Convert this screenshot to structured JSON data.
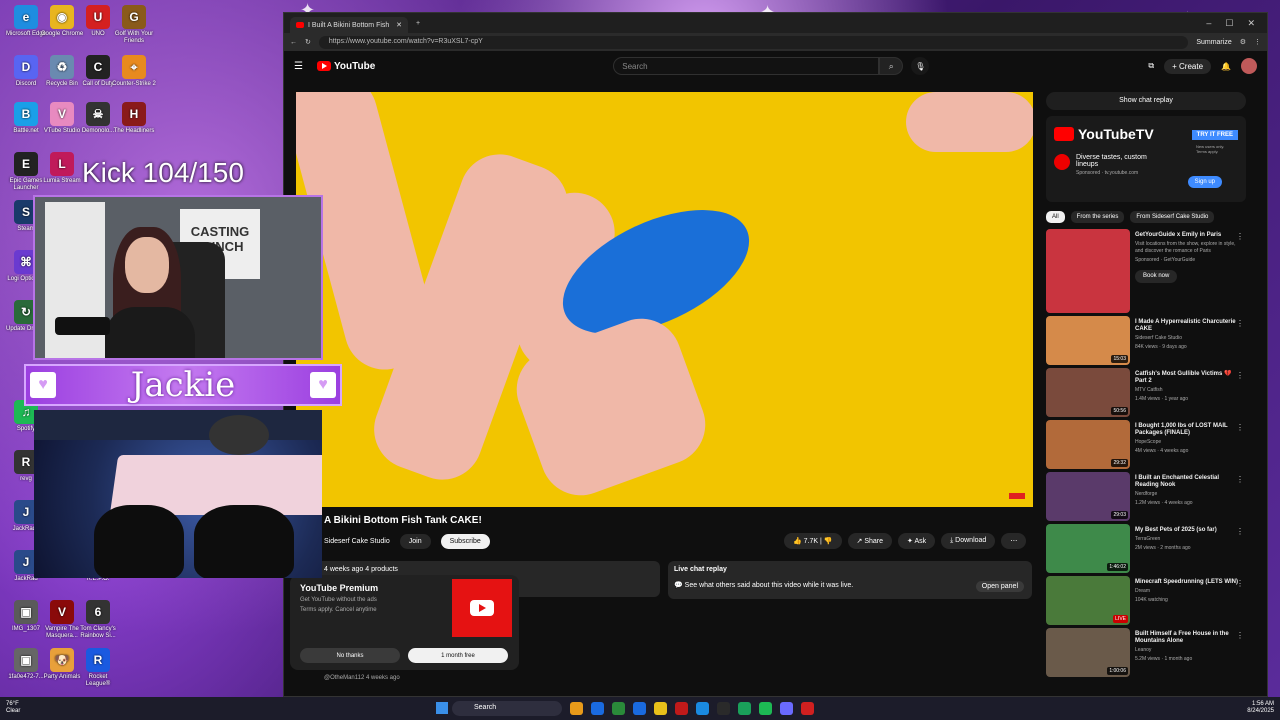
{
  "browser": {
    "tab_title": "I Built A Bikini Bottom Fish",
    "url": "https://www.youtube.com/watch?v=R3uXSL7-cpY",
    "summarize_label": "Summarize"
  },
  "youtube": {
    "logo_text": "YouTube",
    "search_placeholder": "Search",
    "create_label": "Create",
    "video": {
      "title": "A Bikini Bottom Fish Tank CAKE!",
      "channel": "Sideserf Cake Studio",
      "join_label": "Join",
      "subscribe_label": "Subscribe",
      "likes": "7.7K",
      "share_label": "Share",
      "ask_label": "Ask",
      "download_label": "Download",
      "meta": "4 weeks ago  4 products"
    },
    "live_chat": {
      "title": "Live chat replay",
      "text": "See what others said about this video while it was live.",
      "open_label": "Open panel"
    },
    "premium": {
      "title": "YouTube Premium",
      "subtitle": "Get YouTube without the ads",
      "terms": "Terms apply. Cancel anytime",
      "no_label": "No thanks",
      "yes_label": "1 month free"
    },
    "comment_user": "@OtheMan112  4 weeks ago",
    "sidebar": {
      "show_chat_label": "Show chat replay",
      "ad": {
        "brand": "YouTubeTV",
        "try_label": "TRY IT FREE",
        "try_sub": "New users only. Terms apply.",
        "headline": "Diverse tastes, custom lineups",
        "sponsored": "Sponsored · tv.youtube.com",
        "signup_label": "Sign up"
      },
      "chips": [
        "All",
        "From the series",
        "From Sideserf Cake Studio"
      ],
      "recs": [
        {
          "title": "GetYourGuide x Emily in Paris",
          "channel": "Visit locations from the show, explore in style, and discover the romance of Paris",
          "meta": "Sponsored · GetYourGuide",
          "duration": "",
          "book": "Book now",
          "thumb_color": "#c9343f"
        },
        {
          "title": "I Made A Hyperrealistic Charcuterie CAKE",
          "channel": "Sideserf Cake Studio",
          "meta": "84K views · 9 days ago",
          "duration": "15:03",
          "thumb_color": "#d58a4a"
        },
        {
          "title": "Catfish's Most Gullible Victims 💔 Part 2",
          "channel": "MTV Catfish",
          "meta": "1.4M views · 1 year ago",
          "duration": "50:56",
          "thumb_color": "#7a4a3c"
        },
        {
          "title": "I Bought 1,000 lbs of LOST MAIL Packages (FINALE)",
          "channel": "HopeScope",
          "meta": "4M views · 4 weeks ago",
          "duration": "29:32",
          "thumb_color": "#b26a3a"
        },
        {
          "title": "I Built an Enchanted Celestial Reading Nook",
          "channel": "Nerdforge",
          "meta": "1.2M views · 4 weeks ago",
          "duration": "29:03",
          "thumb_color": "#5a3a6a"
        },
        {
          "title": "My Best Pets of 2025 (so far)",
          "channel": "TerraGreen",
          "meta": "2M views · 2 months ago",
          "duration": "1:46:02",
          "thumb_color": "#3e8a4a"
        },
        {
          "title": "Minecraft Speedrunning (LETS WIN)",
          "channel": "Dream",
          "meta": "104K watching",
          "duration": "LIVE",
          "thumb_color": "#4a7a3a"
        },
        {
          "title": "Built Himself a Free House in the Mountains Alone",
          "channel": "Leanoy",
          "meta": "5.2M views · 1 month ago",
          "duration": "1:00:06",
          "thumb_color": "#6a5a4a"
        }
      ]
    }
  },
  "overlay": {
    "kick_counter": "Kick 104/150",
    "streamer_name": "Jackie",
    "poster_text": "CASTING BUNCH"
  },
  "desktop_icons": [
    {
      "label": "Microsoft Edge",
      "color": "#1f8de0",
      "glyph": "e"
    },
    {
      "label": "Google Chrome",
      "color": "#e8b51f",
      "glyph": "◉"
    },
    {
      "label": "UNO",
      "color": "#d42020",
      "glyph": "U"
    },
    {
      "label": "Golf With Your Friends",
      "color": "#8a5a1a",
      "glyph": "G"
    },
    {
      "label": "Discord",
      "color": "#5865f2",
      "glyph": "D"
    },
    {
      "label": "Recycle Bin",
      "color": "#6a8ab0",
      "glyph": "♻"
    },
    {
      "label": "Call of Duty",
      "color": "#222",
      "glyph": "C"
    },
    {
      "label": "Counter-Strike 2",
      "color": "#e88a1f",
      "glyph": "⌖"
    },
    {
      "label": "Battle.net",
      "color": "#1a9fe8",
      "glyph": "B"
    },
    {
      "label": "VTube Studio",
      "color": "#e88ac0",
      "glyph": "V"
    },
    {
      "label": "Demonolo...",
      "color": "#333",
      "glyph": "☠"
    },
    {
      "label": "The Headliners",
      "color": "#8a1a1a",
      "glyph": "H"
    },
    {
      "label": "Epic Games Launcher",
      "color": "#222",
      "glyph": "E"
    },
    {
      "label": "Lumia Stream",
      "color": "#c01a5a",
      "glyph": "L"
    },
    {
      "label": "Steam",
      "color": "#1a3a6a",
      "glyph": "S"
    },
    {
      "label": "Logi Options+",
      "color": "#6a3ad0",
      "glyph": "⌘"
    },
    {
      "label": "Update Drivers",
      "color": "#2a6a3a",
      "glyph": "↻"
    },
    {
      "label": "Spotify",
      "color": "#1db954",
      "glyph": "♫"
    },
    {
      "label": "revg",
      "color": "#333",
      "glyph": "R"
    },
    {
      "label": "JackRad2",
      "color": "#2a4a8a",
      "glyph": "J"
    },
    {
      "label": "JackRad",
      "color": "#2a4a8a",
      "glyph": "J"
    },
    {
      "label": "R.E.P.O.",
      "color": "#444",
      "glyph": "R"
    },
    {
      "label": "IMG_1307",
      "color": "#5a5a5a",
      "glyph": "▣"
    },
    {
      "label": "Vampire The Masquera...",
      "color": "#8a0a0a",
      "glyph": "V"
    },
    {
      "label": "Tom Clancy's Rainbow Si...",
      "color": "#333",
      "glyph": "6"
    },
    {
      "label": "1fa0e472-7...",
      "color": "#666",
      "glyph": "▣"
    },
    {
      "label": "Party Animals",
      "color": "#e8a03a",
      "glyph": "🐶"
    },
    {
      "label": "Rocket League®",
      "color": "#1a5ae0",
      "glyph": "R"
    }
  ],
  "taskbar": {
    "weather_temp": "76°F",
    "weather_desc": "Clear",
    "search_label": "Search",
    "time": "1:56 AM",
    "date": "8/24/2025",
    "app_colors": [
      "#e89a1a",
      "#1a6ae0",
      "#2a8a3a",
      "#1a6ae0",
      "#e8c01a",
      "#c01a1a",
      "#1a8ae0",
      "#2a2a2a",
      "#1aa05a",
      "#1db954",
      "#6a6aff",
      "#d02020"
    ]
  }
}
